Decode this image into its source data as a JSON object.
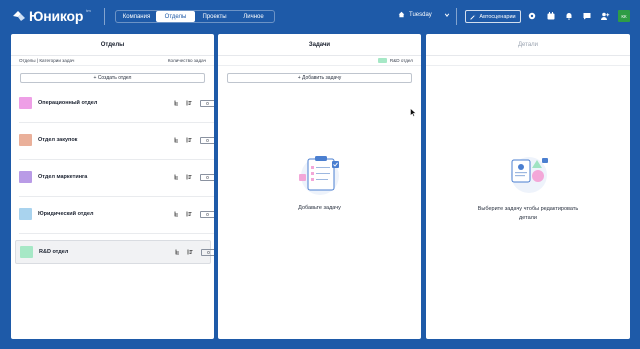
{
  "app": {
    "logo_text": "Юникор",
    "logo_tm": "tm",
    "brand_color": "#1e5aa8"
  },
  "nav": {
    "tabs": [
      {
        "label": "Компания",
        "active": false
      },
      {
        "label": "Отделы",
        "active": true
      },
      {
        "label": "Проекты",
        "active": false
      },
      {
        "label": "Личное",
        "active": false
      }
    ]
  },
  "header": {
    "workspace_label": "Tuesday",
    "workspace_icon": "home-icon",
    "scenarios_label": "Автосценарии",
    "scenarios_icon": "wand-icon",
    "toolbar_icons": [
      "settings-icon",
      "calendar-icon",
      "bell-icon",
      "chat-icon",
      "add-user-icon"
    ],
    "avatar_initials": "КК",
    "avatar_color": "#2e9c45"
  },
  "departments_panel": {
    "title": "Отделы",
    "col_left": "Отделы | Категории задач",
    "col_right": "Количество задач",
    "create_label": "+ Создать отдел",
    "items": [
      {
        "name": "Операционный отдел",
        "color": "#ee9fe6",
        "count": "0",
        "selected": false
      },
      {
        "name": "Отдел закупок",
        "color": "#eab09a",
        "count": "0",
        "selected": false
      },
      {
        "name": "Отдел маркетинга",
        "color": "#b99be6",
        "count": "0",
        "selected": false
      },
      {
        "name": "Юридический отдел",
        "color": "#a9d3ee",
        "count": "0",
        "selected": false
      },
      {
        "name": "R&D отдел",
        "color": "#a6e8c6",
        "count": "0",
        "selected": true
      }
    ]
  },
  "tasks_panel": {
    "title": "Задачи",
    "filter_label": "R&D отдел",
    "filter_color": "#a6e8c6",
    "add_label": "+ Добавить задачу",
    "empty_text": "Добавьте задачу"
  },
  "details_panel": {
    "title": "Детали",
    "empty_line1": "Выберите задачу чтобы редактировать",
    "empty_line2": "детали"
  }
}
